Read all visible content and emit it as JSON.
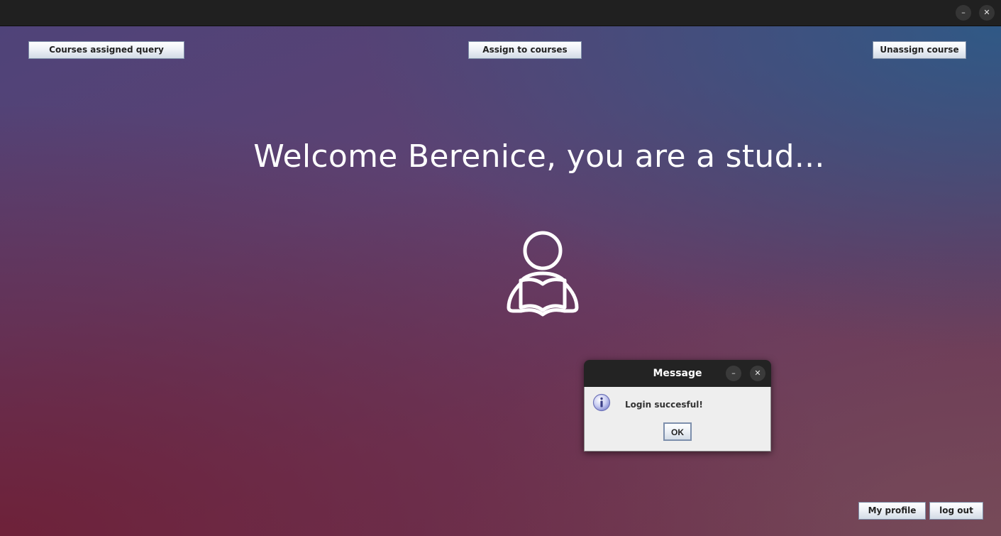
{
  "window": {
    "controls": {
      "minimize_label": "–",
      "close_label": "✕"
    }
  },
  "toolbar": {
    "courses_assigned_query_label": "Courses assigned query",
    "assign_to_courses_label": "Assign to courses",
    "unassign_course_label": "Unassign course"
  },
  "main": {
    "welcome_text": "Welcome Berenice, you are a stud...",
    "avatar_icon": "student-reading-icon"
  },
  "footer": {
    "my_profile_label": "My profile",
    "log_out_label": "log out"
  },
  "dialog": {
    "title": "Message",
    "minimize_label": "–",
    "close_label": "✕",
    "icon": "info-icon",
    "message": "Login succesful!",
    "ok_label": "OK"
  },
  "colors": {
    "gradient_top_left": "#4f4379",
    "gradient_top_right": "#2d5a87",
    "gradient_bottom_left": "#6e2037",
    "titlebar": "#202020",
    "dialog_body": "#eeeeee"
  }
}
